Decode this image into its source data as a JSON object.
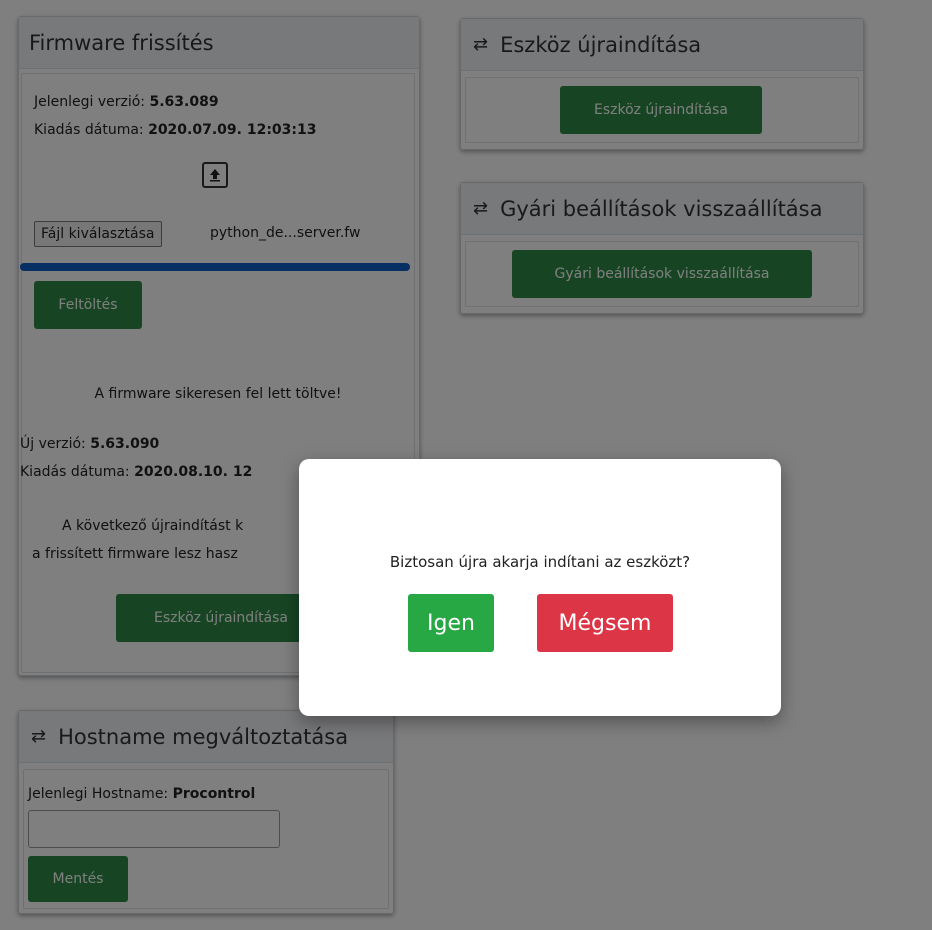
{
  "firmware": {
    "title": "Firmware frissítés",
    "current_version_label": "Jelenlegi verzió:",
    "current_version": "5.63.089",
    "release_date_label": "Kiadás dátuma:",
    "release_date": "2020.07.09. 12:03:13",
    "upload_icon": "upload-icon",
    "choose_file_label": "Fájl kiválasztása",
    "file_name": "python_de...server.fw",
    "progress": 1.0,
    "upload_button": "Feltöltés",
    "success_message": "A firmware sikeresen fel lett töltve!",
    "new_version_label": "Új verzió:",
    "new_version": "5.63.090",
    "new_release_date_label": "Kiadás dátuma:",
    "new_release_date": "2020.08.10. 12",
    "restart_note_line1": "A következő újraindítást k",
    "restart_note_line2": "a frissített firmware lesz hasz",
    "restart_button": "Eszköz újraindítása"
  },
  "device_restart": {
    "title": "Eszköz újraindítása",
    "button": "Eszköz újraindítása"
  },
  "factory_reset": {
    "title": "Gyári beállítások visszaállítása",
    "button": "Gyári beállítások visszaállítása"
  },
  "hostname": {
    "title": "Hostname megváltoztatása",
    "current_label": "Jelenlegi Hostname:",
    "current_value": "Procontrol",
    "input_value": "",
    "save_button": "Mentés"
  },
  "dialog": {
    "question": "Biztosan újra akarja indítani az eszközt?",
    "yes_button": "Igen",
    "cancel_button": "Mégsem"
  },
  "colors": {
    "green": "#2e8b46",
    "dialog_yes": "#28a745",
    "dialog_cancel": "#dc3545",
    "progress": "#0d5fc7"
  }
}
